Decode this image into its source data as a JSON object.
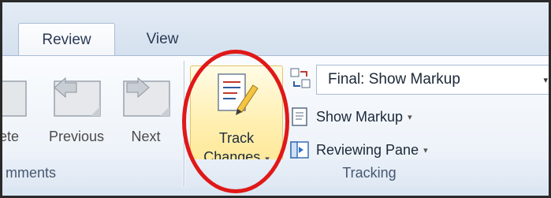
{
  "tabs": {
    "review": "Review",
    "view": "View"
  },
  "comments_group": {
    "delete_partial": "ete",
    "previous": "Previous",
    "next": "Next",
    "footer_partial": "mments"
  },
  "tracking_group": {
    "track_changes_line1": "Track",
    "track_changes_line2": "Changes",
    "display_dropdown_value": "Final: Show Markup",
    "show_markup": "Show Markup",
    "reviewing_pane": "Reviewing Pane",
    "footer": "Tracking"
  },
  "caret": "▾",
  "highlight_color": "#e01818"
}
